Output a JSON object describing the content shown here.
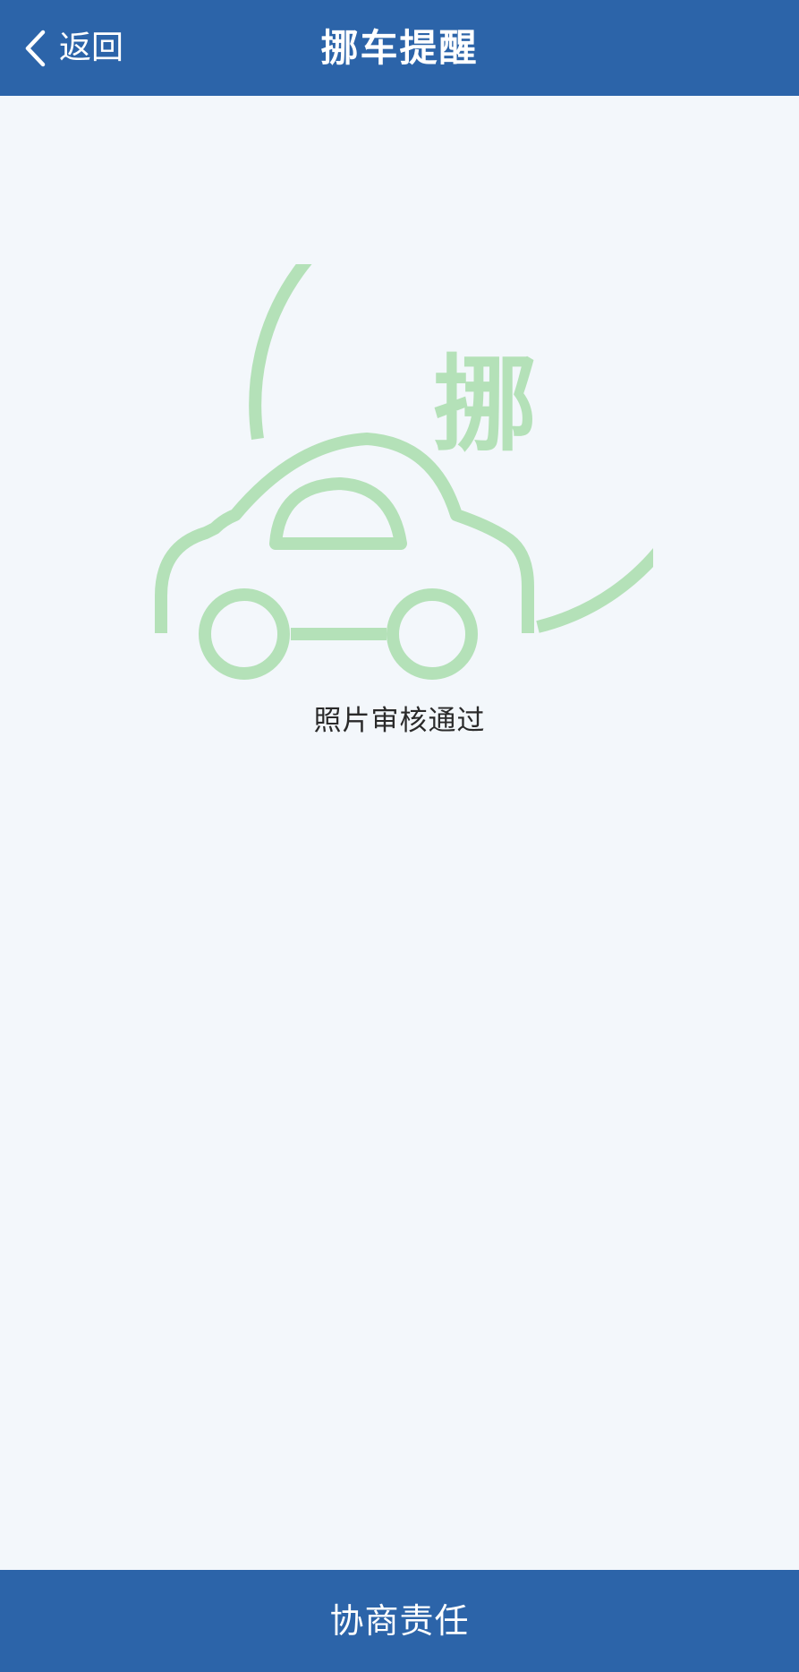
{
  "header": {
    "back_label": "返回",
    "title": "挪车提醒"
  },
  "main": {
    "badge_char": "挪",
    "status_text": "照片审核通过"
  },
  "footer": {
    "action_label": "协商责任"
  },
  "colors": {
    "header_bg": "#2c64a9",
    "page_bg": "#f3f7fb",
    "illustration": "#b4e1b8",
    "status_text": "#2a2a2a",
    "footer_bg": "#2c64a9",
    "header_text": "#ffffff"
  },
  "icons": {
    "back": "chevron-left-icon",
    "illustration": "car-move-icon"
  }
}
